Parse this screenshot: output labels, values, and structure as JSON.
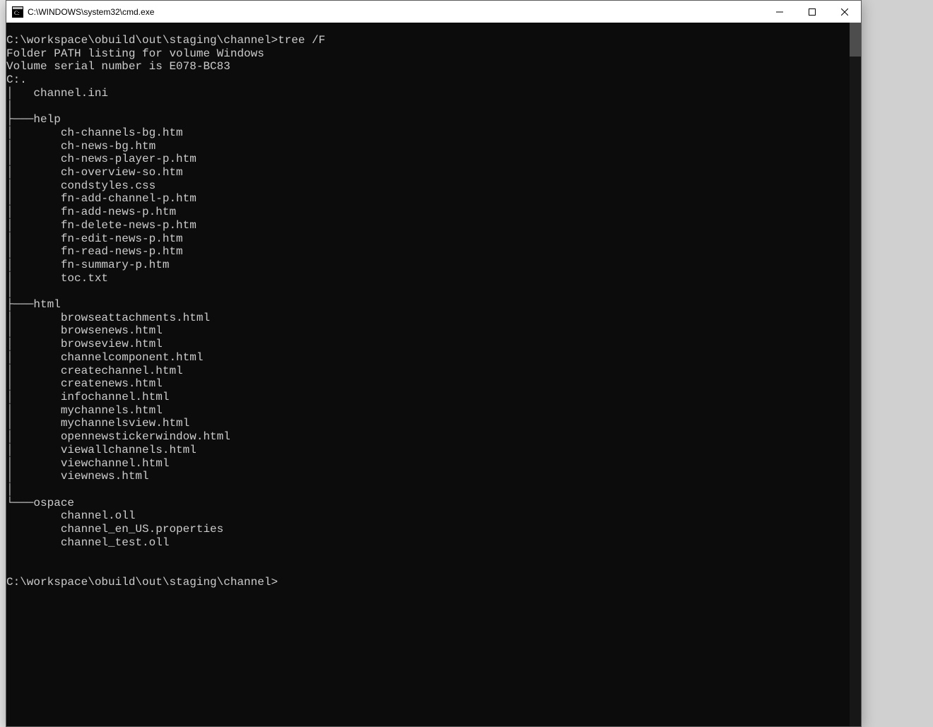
{
  "titlebar": {
    "title": "C:\\WINDOWS\\system32\\cmd.exe"
  },
  "terminal": {
    "prompt1_path": "C:\\workspace\\obuild\\out\\staging\\channel>",
    "prompt1_cmd": "tree /F",
    "line_folder_path": "Folder PATH listing for volume Windows",
    "line_serial": "Volume serial number is E078-BC83",
    "line_root": "C:.",
    "root_files": [
      "channel.ini"
    ],
    "dirs": [
      {
        "name": "help",
        "connector": "mid",
        "files": [
          "ch-channels-bg.htm",
          "ch-news-bg.htm",
          "ch-news-player-p.htm",
          "ch-overview-so.htm",
          "condstyles.css",
          "fn-add-channel-p.htm",
          "fn-add-news-p.htm",
          "fn-delete-news-p.htm",
          "fn-edit-news-p.htm",
          "fn-read-news-p.htm",
          "fn-summary-p.htm",
          "toc.txt"
        ]
      },
      {
        "name": "html",
        "connector": "mid",
        "files": [
          "browseattachments.html",
          "browsenews.html",
          "browseview.html",
          "channelcomponent.html",
          "createchannel.html",
          "createnews.html",
          "infochannel.html",
          "mychannels.html",
          "mychannelsview.html",
          "opennewstickerwindow.html",
          "viewallchannels.html",
          "viewchannel.html",
          "viewnews.html"
        ]
      },
      {
        "name": "ospace",
        "connector": "last",
        "files": [
          "channel.oll",
          "channel_en_US.properties",
          "channel_test.oll"
        ]
      }
    ],
    "prompt2_path": "C:\\workspace\\obuild\\out\\staging\\channel>"
  }
}
